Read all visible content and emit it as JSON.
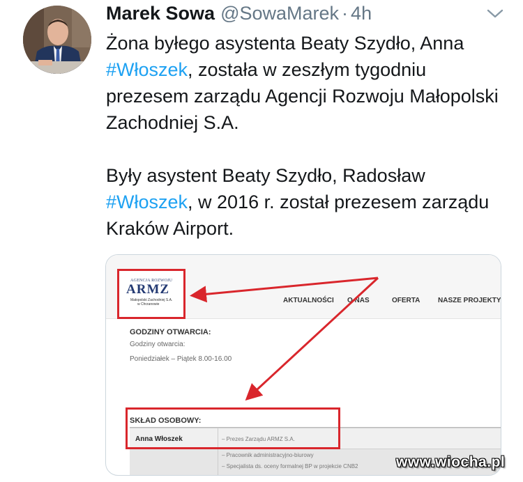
{
  "tweet": {
    "author_name": "Marek Sowa",
    "handle": "@SowaMarek",
    "separator": "·",
    "time": "4h",
    "text_para1_a": "Żona byłego asystenta Beaty Szydło, Anna ",
    "hashtag1": "#Włoszek",
    "text_para1_b": ", została w zeszłym tygodniu prezesem zarządu Agencji Rozwoju Małopolski Zachodniej S.A.",
    "text_para2_a": "Były asystent Beaty Szydło, Radosław ",
    "hashtag2": "#Włoszek",
    "text_para2_b": ", w 2016 r. został prezesem zarządu Kraków Airport.",
    "hashtag_color": "#1da1f2",
    "menu_icon": "chevron-down-icon"
  },
  "media": {
    "logo": {
      "top_text": "AGENCJA ROZWOJU",
      "main_text": "ARMZ",
      "sub_text_1": "Małopolski Zachodniej S.A.",
      "sub_text_2": "w Chrzanowie"
    },
    "nav": [
      "AKTUALNOŚCI",
      "O NAS",
      "OFERTA",
      "NASZE PROJEKTY"
    ],
    "hours_title": "GODZINY OTWARCIA:",
    "hours_label": "Godziny otwarcia:",
    "hours_value": "Poniedziałek – Piątek 8.00-16.00",
    "staff_title": "SKŁAD OSOBOWY:",
    "staff_rows": [
      {
        "name": "Anna Włoszek",
        "roles": [
          "– Prezes Zarządu ARMZ S.A."
        ]
      },
      {
        "name": "",
        "roles": [
          "– Pracownik administracyjno-biurowy",
          "– Specjalista ds. oceny formalnej BP w projekcie CNB2"
        ]
      }
    ],
    "highlight_color": "#d9262c"
  },
  "watermark": "www.wiocha.pl"
}
